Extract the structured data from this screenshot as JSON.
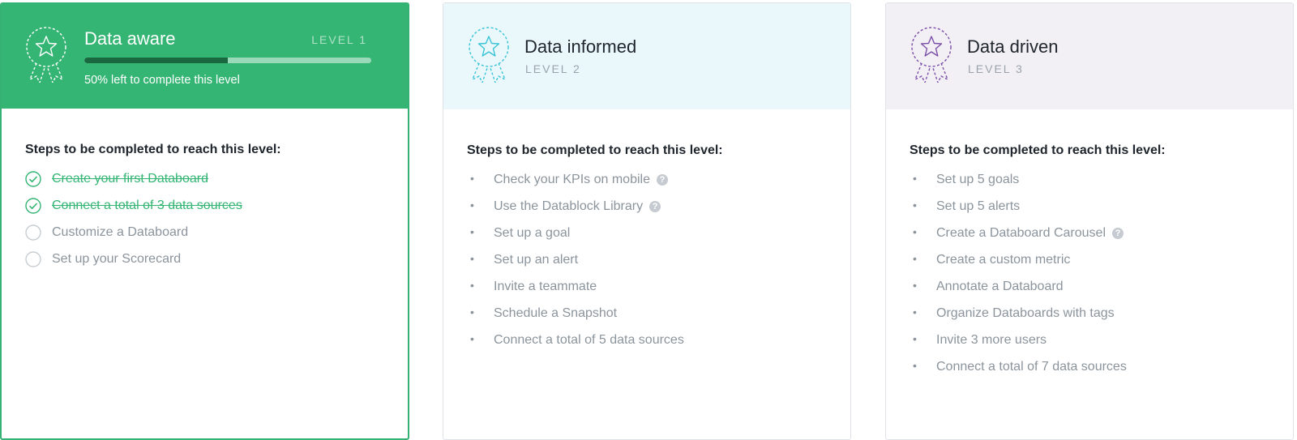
{
  "colors": {
    "level1_accent": "#35b574",
    "level2_accent": "#38c4d6",
    "level3_accent": "#7b4fa8"
  },
  "cards": [
    {
      "title": "Data aware",
      "level": "LEVEL 1",
      "progress_text": "50% left to complete this level",
      "progress_completed_fraction": 0.5,
      "steps_heading": "Steps to be completed to reach this level:",
      "steps": [
        {
          "label": "Create your first Databoard",
          "done": true
        },
        {
          "label": "Connect a total of 3 data sources",
          "done": true
        },
        {
          "label": "Customize a Databoard",
          "done": false
        },
        {
          "label": "Set up your Scorecard",
          "done": false
        }
      ]
    },
    {
      "title": "Data informed",
      "level": "LEVEL 2",
      "steps_heading": "Steps to be completed to reach this level:",
      "steps": [
        {
          "label": "Check your KPIs on mobile",
          "help": true
        },
        {
          "label": "Use the Datablock Library",
          "help": true
        },
        {
          "label": "Set up a goal"
        },
        {
          "label": "Set up an alert"
        },
        {
          "label": "Invite a teammate"
        },
        {
          "label": "Schedule a Snapshot"
        },
        {
          "label": "Connect a total of 5 data sources"
        }
      ]
    },
    {
      "title": "Data driven",
      "level": "LEVEL 3",
      "steps_heading": "Steps to be completed to reach this level:",
      "steps": [
        {
          "label": "Set up 5 goals"
        },
        {
          "label": "Set up 5 alerts"
        },
        {
          "label": "Create a Databoard Carousel",
          "help": true
        },
        {
          "label": "Create a custom metric"
        },
        {
          "label": "Annotate a Databoard"
        },
        {
          "label": "Organize Databoards with tags"
        },
        {
          "label": "Invite 3 more users"
        },
        {
          "label": "Connect a total of 7 data sources"
        }
      ]
    }
  ],
  "icons": {
    "badge": "award-ribbon-icon",
    "help": "question-circle-icon",
    "check": "check-circle-icon",
    "empty": "empty-circle-icon",
    "bullet": "bullet-dot-icon"
  },
  "glyphs": {
    "help": "?",
    "bullet": "•"
  }
}
